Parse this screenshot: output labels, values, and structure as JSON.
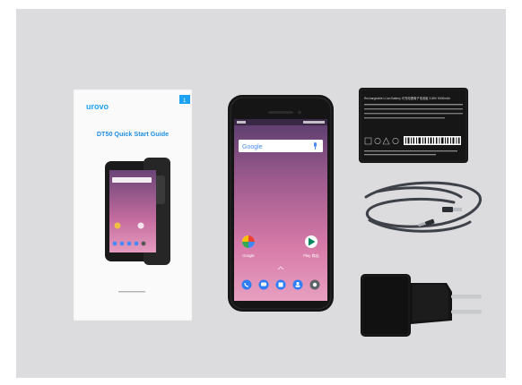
{
  "colors": {
    "background": "#dcdcde",
    "accent_blue": "#1da1f2",
    "guide_title_blue": "#1f8fe3",
    "device_black": "#151515"
  },
  "guide": {
    "brand": "urovo",
    "page_number": "1",
    "title": "DT50 Quick Start Guide"
  },
  "phone": {
    "search_label": "Google",
    "apps": [
      {
        "name": "Google",
        "icon": "photos-pinwheel-icon"
      },
      {
        "name": "Play 商店",
        "icon": "play-store-icon"
      }
    ],
    "dock_icons": [
      "phone-icon",
      "messages-icon",
      "calendar-icon",
      "contacts-icon",
      "camera-icon"
    ]
  },
  "battery": {
    "heading": "Rechargeable Li-ion Battery 可充电锂离子电池组 3.85V 5000mAh"
  }
}
